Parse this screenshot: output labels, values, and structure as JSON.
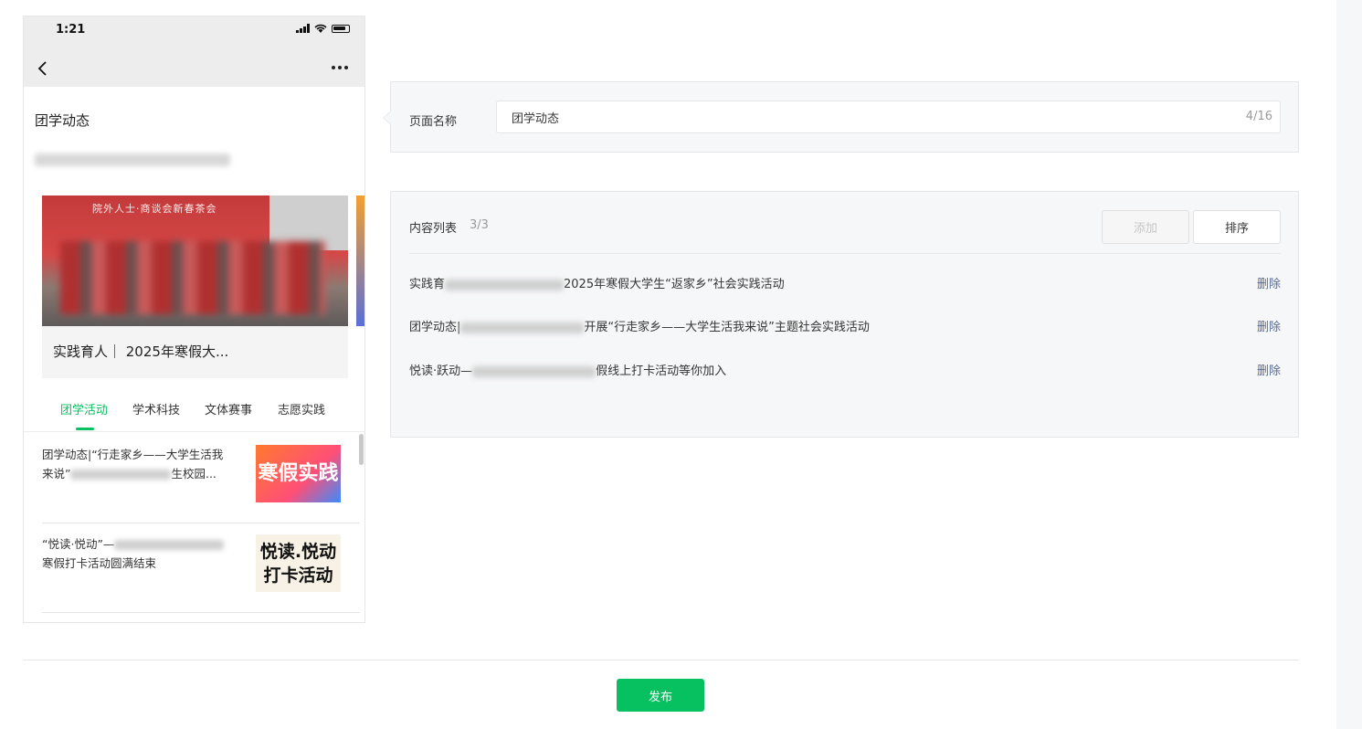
{
  "status_bar": {
    "time": "1:21"
  },
  "preview": {
    "page_title": "团学动态",
    "banner": {
      "title": "实践育人｜ 2025年寒假大...",
      "image_sign": "院外人士·商谈会新春茶会"
    },
    "tabs": [
      {
        "label": "团学活动",
        "active": true
      },
      {
        "label": "学术科技",
        "active": false
      },
      {
        "label": "文体赛事",
        "active": false
      },
      {
        "label": "志愿实践",
        "active": false
      }
    ],
    "articles": [
      {
        "line1": "团学动态|“行走家乡——大学生活我",
        "line2_prefix": "来说”",
        "line2_suffix": "生校园...",
        "thumb_text": "寒假实践"
      },
      {
        "line1_prefix": "“悦读·悦动”—",
        "line2": "寒假打卡活动圆满结束",
        "thumb_text": "悦读.悦动打卡活动"
      }
    ]
  },
  "name_panel": {
    "label": "页面名称",
    "value": "团学动态",
    "counter": "4/16"
  },
  "list_panel": {
    "label": "内容列表",
    "count": "3/3",
    "add_label": "添加",
    "sort_label": "排序",
    "delete_label": "删除",
    "rows": [
      {
        "prefix": "实践育",
        "suffix": "2025年寒假大学生“返家乡”社会实践活动"
      },
      {
        "prefix": "团学动态|",
        "suffix": "开展“行走家乡——大学生活我来说”主题社会实践活动"
      },
      {
        "prefix": "悦读·跃动—",
        "suffix": "假线上打卡活动等你加入"
      }
    ]
  },
  "footer": {
    "publish_label": "发布"
  },
  "colors": {
    "accent": "#07c160",
    "link": "#576b95",
    "panel_bg": "#f6f7f8"
  }
}
